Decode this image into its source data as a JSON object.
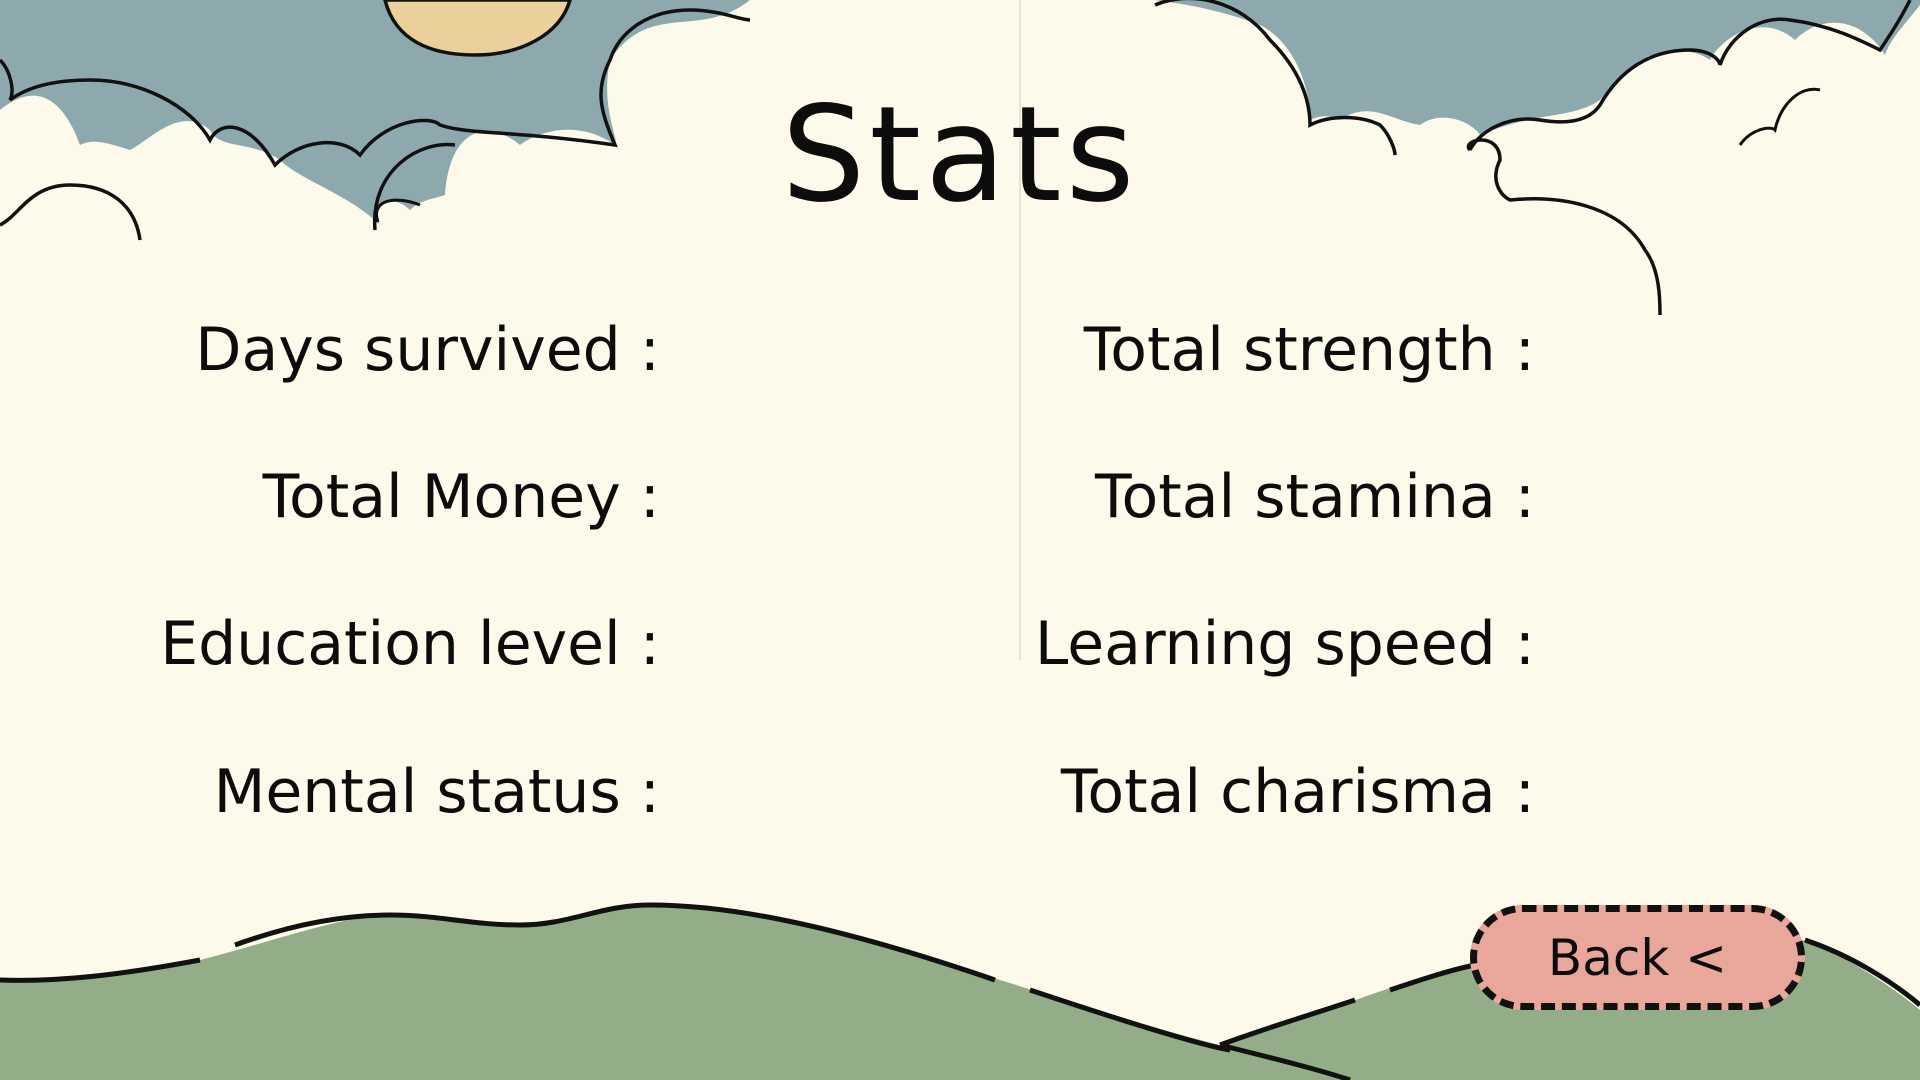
{
  "screen": {
    "title": "Stats"
  },
  "stats": {
    "left": [
      {
        "label": "Days survived :"
      },
      {
        "label": "Total Money :"
      },
      {
        "label": "Education level :"
      },
      {
        "label": "Mental status :"
      }
    ],
    "right": [
      {
        "label": "Total strength :"
      },
      {
        "label": "Total stamina :"
      },
      {
        "label": "Learning speed :"
      },
      {
        "label": "Total charisma :"
      }
    ]
  },
  "controls": {
    "back_label": "Back <"
  },
  "colors": {
    "background": "#fdfaec",
    "sky": "#8ea9ae",
    "sun": "#ead19c",
    "hills": "#93ad88",
    "back_button": "#e9a69a",
    "outline": "#111111"
  }
}
